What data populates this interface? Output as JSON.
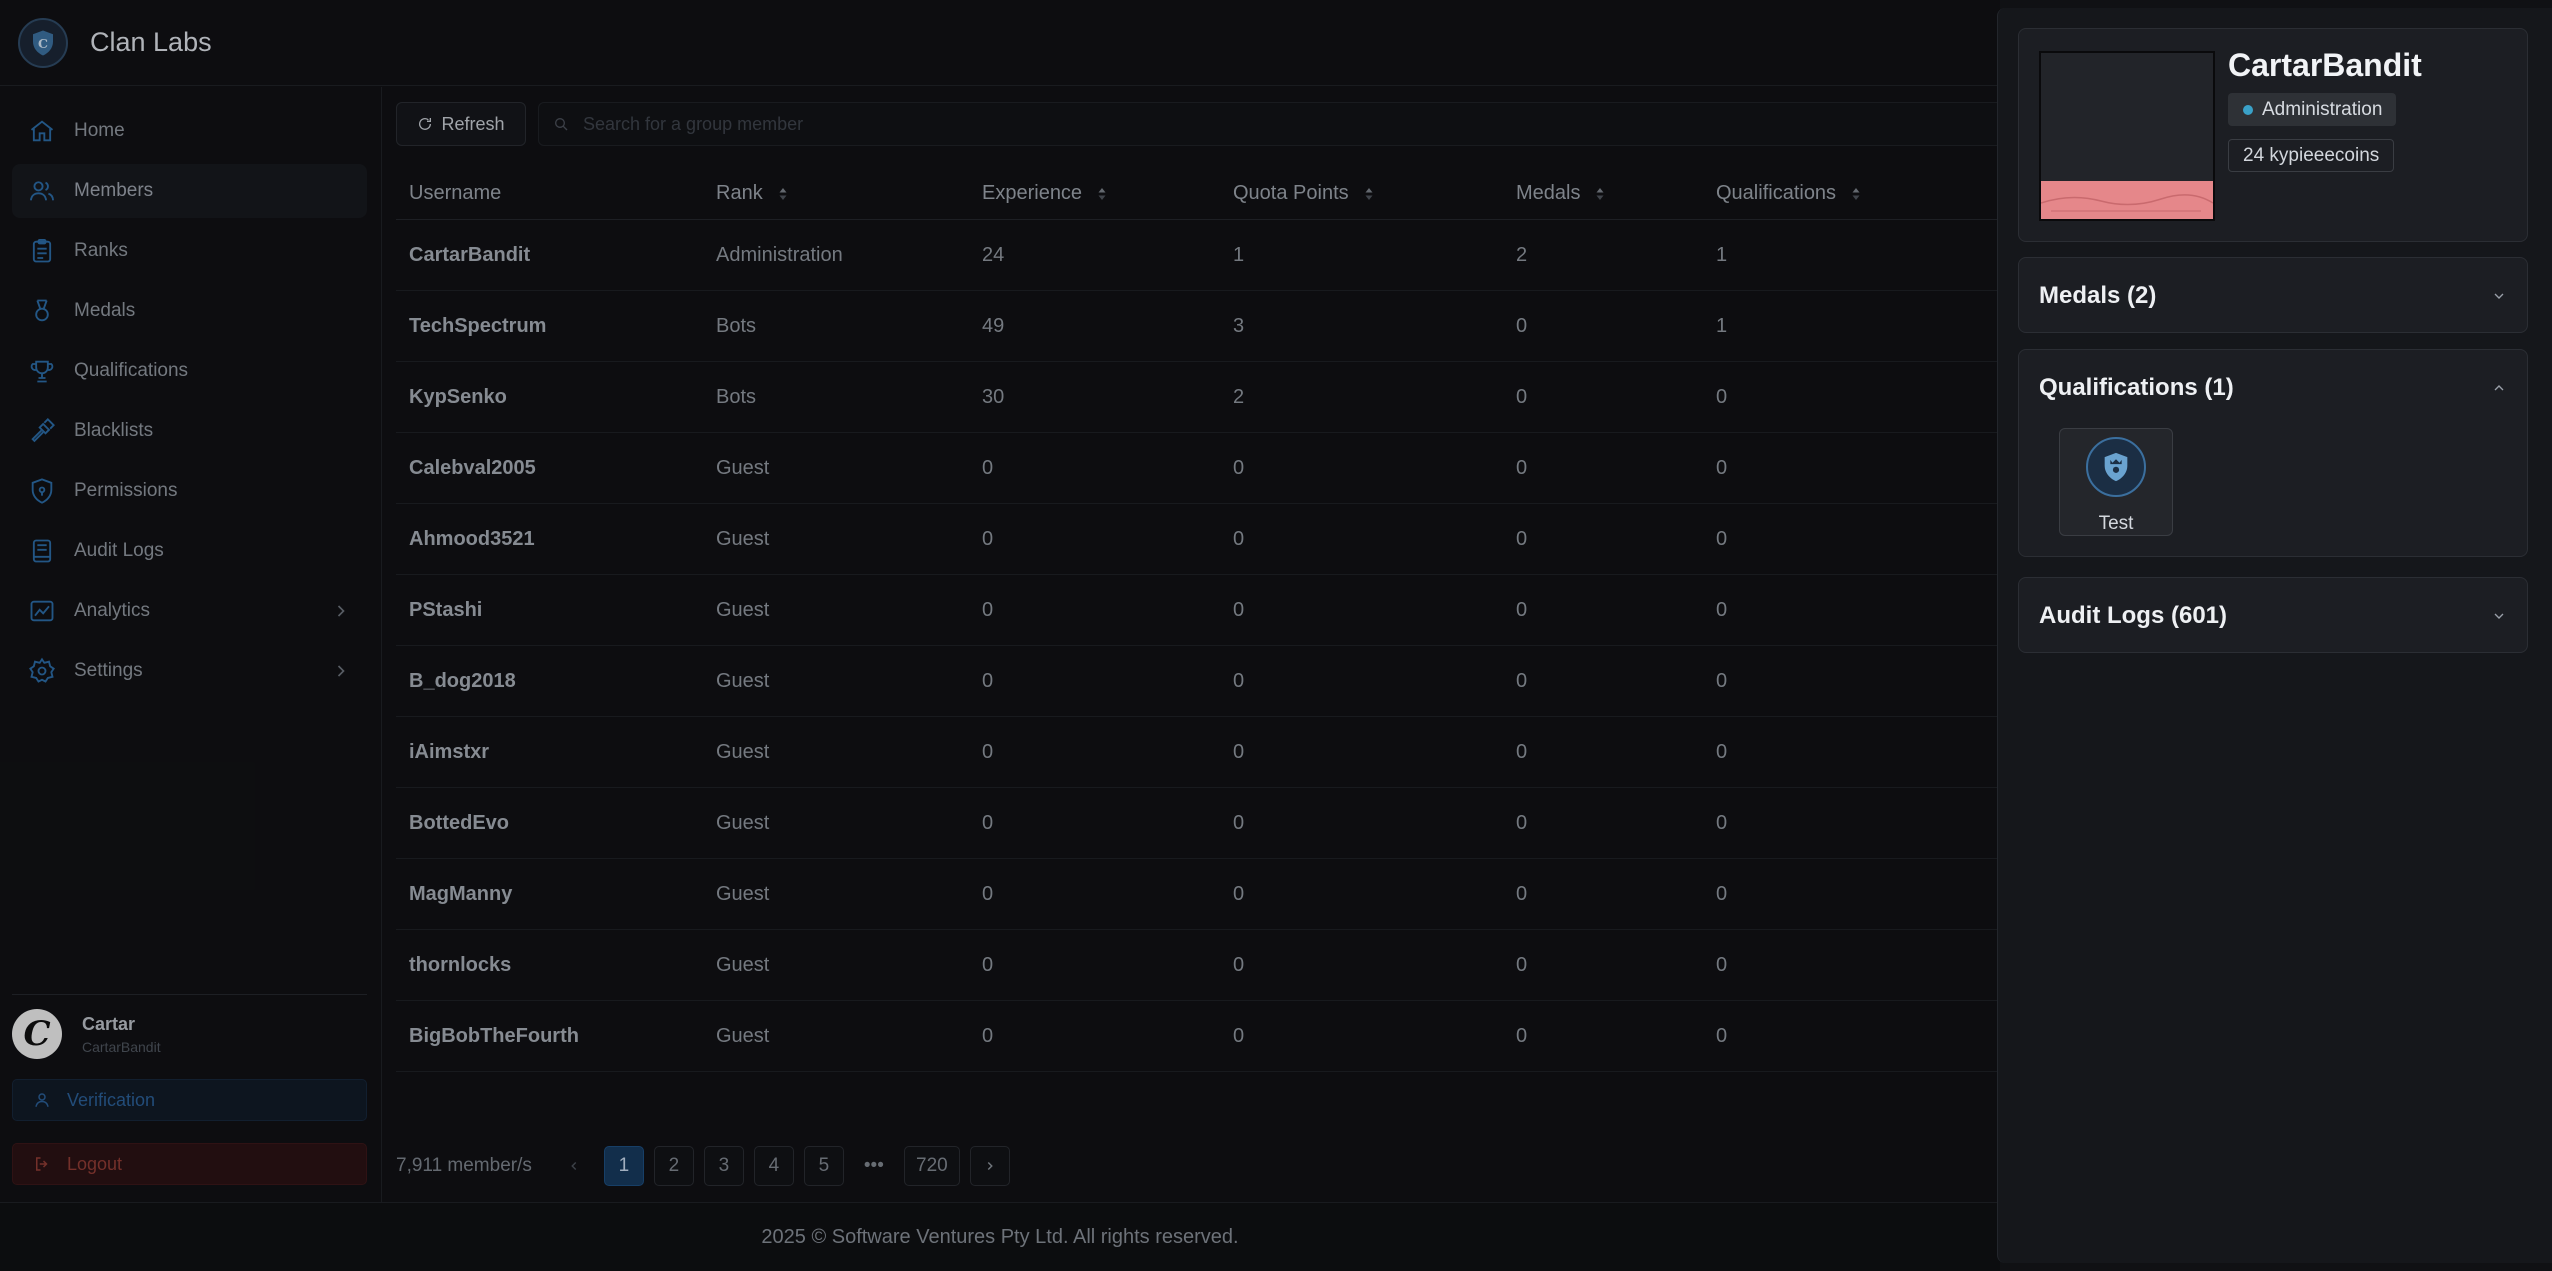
{
  "app": {
    "brand": "Clan Labs",
    "logo_icon": "shield-logo-icon"
  },
  "sidebar": {
    "items": [
      {
        "label": "Home",
        "icon": "home-icon"
      },
      {
        "label": "Members",
        "icon": "users-icon",
        "active": true
      },
      {
        "label": "Ranks",
        "icon": "clipboard-icon"
      },
      {
        "label": "Medals",
        "icon": "medal-icon"
      },
      {
        "label": "Qualifications",
        "icon": "trophy-icon"
      },
      {
        "label": "Blacklists",
        "icon": "hammer-icon"
      },
      {
        "label": "Permissions",
        "icon": "shield-icon"
      },
      {
        "label": "Audit Logs",
        "icon": "book-icon"
      },
      {
        "label": "Analytics",
        "icon": "chart-icon",
        "expandable": true
      },
      {
        "label": "Settings",
        "icon": "gear-icon",
        "expandable": true
      }
    ],
    "user": {
      "name": "Cartar",
      "username": "CartarBandit",
      "avatar_letter": "C"
    },
    "verification_label": "Verification",
    "logout_label": "Logout"
  },
  "toolbar": {
    "refresh_label": "Refresh",
    "search_placeholder": "Search for a group member"
  },
  "table": {
    "headers": [
      "Username",
      "Rank",
      "Experience",
      "Quota Points",
      "Medals",
      "Qualifications"
    ],
    "rows": [
      [
        "CartarBandit",
        "Administration",
        "24",
        "1",
        "2",
        "1"
      ],
      [
        "TechSpectrum",
        "Bots",
        "49",
        "3",
        "0",
        "1"
      ],
      [
        "KypSenko",
        "Bots",
        "30",
        "2",
        "0",
        "0"
      ],
      [
        "Calebval2005",
        "Guest",
        "0",
        "0",
        "0",
        "0"
      ],
      [
        "Ahmood3521",
        "Guest",
        "0",
        "0",
        "0",
        "0"
      ],
      [
        "PStashi",
        "Guest",
        "0",
        "0",
        "0",
        "0"
      ],
      [
        "B_dog2018",
        "Guest",
        "0",
        "0",
        "0",
        "0"
      ],
      [
        "iAimstxr",
        "Guest",
        "0",
        "0",
        "0",
        "0"
      ],
      [
        "BottedEvo",
        "Guest",
        "0",
        "0",
        "0",
        "0"
      ],
      [
        "MagManny",
        "Guest",
        "0",
        "0",
        "0",
        "0"
      ],
      [
        "thornlocks",
        "Guest",
        "0",
        "0",
        "0",
        "0"
      ],
      [
        "BigBobTheFourth",
        "Guest",
        "0",
        "0",
        "0",
        "0"
      ]
    ]
  },
  "pagination": {
    "total_label": "7,911 member/s",
    "pages": [
      "1",
      "2",
      "3",
      "4",
      "5"
    ],
    "ellipsis": "•••",
    "last_page": "720",
    "current": "1"
  },
  "footer": {
    "text": "2025 © Software Ventures Pty Ltd. All rights reserved."
  },
  "drawer": {
    "name": "CartarBandit",
    "role": "Administration",
    "role_dot_color": "#3aa1c8",
    "coins": "24 kypieeecoins",
    "sections": [
      {
        "title": "Medals (2)",
        "expanded": false
      },
      {
        "title": "Qualifications (1)",
        "expanded": true
      },
      {
        "title": "Audit Logs (601)",
        "expanded": false
      }
    ],
    "qualification": {
      "label": "Test",
      "icon": "shield-badge-icon"
    }
  },
  "colors": {
    "accent": "#1d4d7e",
    "background": "#101114",
    "panel": "#1c1e23",
    "danger": "#8e3b34"
  }
}
